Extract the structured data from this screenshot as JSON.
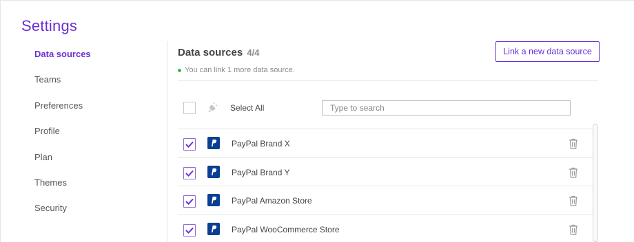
{
  "header": {
    "title": "Settings"
  },
  "sidebar": {
    "items": [
      {
        "label": "Data sources",
        "active": true
      },
      {
        "label": "Teams"
      },
      {
        "label": "Preferences"
      },
      {
        "label": "Profile"
      },
      {
        "label": "Plan"
      },
      {
        "label": "Themes"
      },
      {
        "label": "Security"
      }
    ]
  },
  "main": {
    "title": "Data sources",
    "count": "4/4",
    "hint": "You can link 1 more data source.",
    "link_button": "Link a new data source",
    "select_all_label": "Select All",
    "search": {
      "placeholder": "Type to search",
      "value": ""
    },
    "sources": [
      {
        "name": "PayPal Brand X",
        "checked": true,
        "icon": "paypal-icon"
      },
      {
        "name": "PayPal Brand Y",
        "checked": true,
        "icon": "paypal-icon"
      },
      {
        "name": "PayPal Amazon Store",
        "checked": true,
        "icon": "paypal-icon"
      },
      {
        "name": "PayPal WooCommerce Store",
        "checked": true,
        "icon": "paypal-icon"
      }
    ]
  },
  "colors": {
    "accent": "#6b2fd6",
    "status_ok": "#39b54a",
    "paypal": "#0a3f94"
  }
}
